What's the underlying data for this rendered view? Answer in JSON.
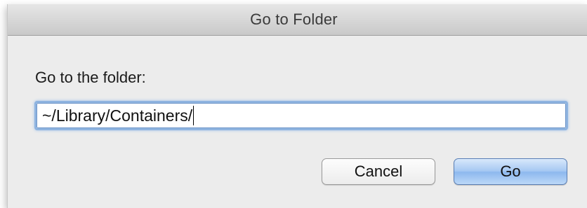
{
  "window": {
    "title": "Go to Folder"
  },
  "form": {
    "prompt_label": "Go to the folder:",
    "path_value": "~/Library/Containers/",
    "path_placeholder": ""
  },
  "buttons": {
    "cancel_label": "Cancel",
    "go_label": "Go"
  },
  "colors": {
    "focus_ring": "#8fb4e0",
    "default_button": "#a6c8f2",
    "titlebar": "#d6d6d6",
    "dialog_background": "#ececec"
  }
}
